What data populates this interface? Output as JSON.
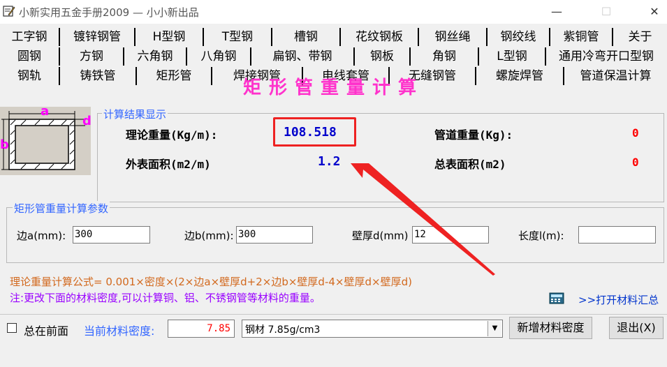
{
  "window": {
    "title": "小新实用五金手册2009 — 小小新出品",
    "minimize": "—",
    "maximize": "☐",
    "close": "✕"
  },
  "tabs": {
    "row1": [
      "工字钢",
      "镀锌钢管",
      "H型钢",
      "T型钢",
      "槽钢",
      "花纹钢板",
      "钢丝绳",
      "钢绞线",
      "紫铜管",
      "关于"
    ],
    "row2": [
      "圆钢",
      "方钢",
      "六角钢",
      "八角钢",
      "扁钢、带钢",
      "钢板",
      "角钢",
      "L型钢",
      "通用冷弯开口型钢"
    ],
    "row3": [
      "钢轨",
      "铸铁管",
      "矩形管",
      "焊接钢管",
      "电线套管",
      "无缝钢管",
      "螺旋焊管",
      "管道保温计算"
    ],
    "active": "矩形管"
  },
  "calc_title": "矩形管重量计算",
  "diagram": {
    "label_a": "a",
    "label_b": "b",
    "label_d": "d"
  },
  "results": {
    "legend": "计算结果显示",
    "theory_weight_label": "理论重量(Kg/m):",
    "theory_weight_value": "108.518",
    "surface_area_label": "外表面积(m2/m)",
    "surface_area_value": "1.2",
    "pipe_weight_label": "管道重量(Kg):",
    "pipe_weight_value": "0",
    "total_area_label": "总表面积(m2)",
    "total_area_value": "0"
  },
  "params": {
    "legend": "矩形管重量计算参数",
    "side_a_label": "边a(mm):",
    "side_a_value": "300",
    "side_b_label": "边b(mm):",
    "side_b_value": "300",
    "thickness_label": "壁厚d(mm)",
    "thickness_value": "12",
    "length_label": "长度l(m):",
    "length_value": ""
  },
  "formula": "理论重量计算公式= 0.001×密度×(2×边a×壁厚d+2×边b×壁厚d-4×壁厚d×壁厚d)",
  "note": "注:更改下面的材料密度,可以计算铜、铝、不锈钢管等材料的重量。",
  "open_materials_link": ">>打开材料汇总",
  "bottom": {
    "always_on_top_label": "总在前面",
    "density_label": "当前材料密度:",
    "density_value": "7.85",
    "material_selected": "钢材 7.85g/cm3",
    "add_density_button": "新增材料密度",
    "exit_button": "退出(X)"
  },
  "colors": {
    "title_magenta": "#ff33cc",
    "value_blue": "#0000cc",
    "zero_red": "#ff0000",
    "legend_blue": "#3366ff",
    "formula_orange": "#d2691e",
    "note_purple": "#9900ff",
    "annotation_red": "#ee2222"
  }
}
